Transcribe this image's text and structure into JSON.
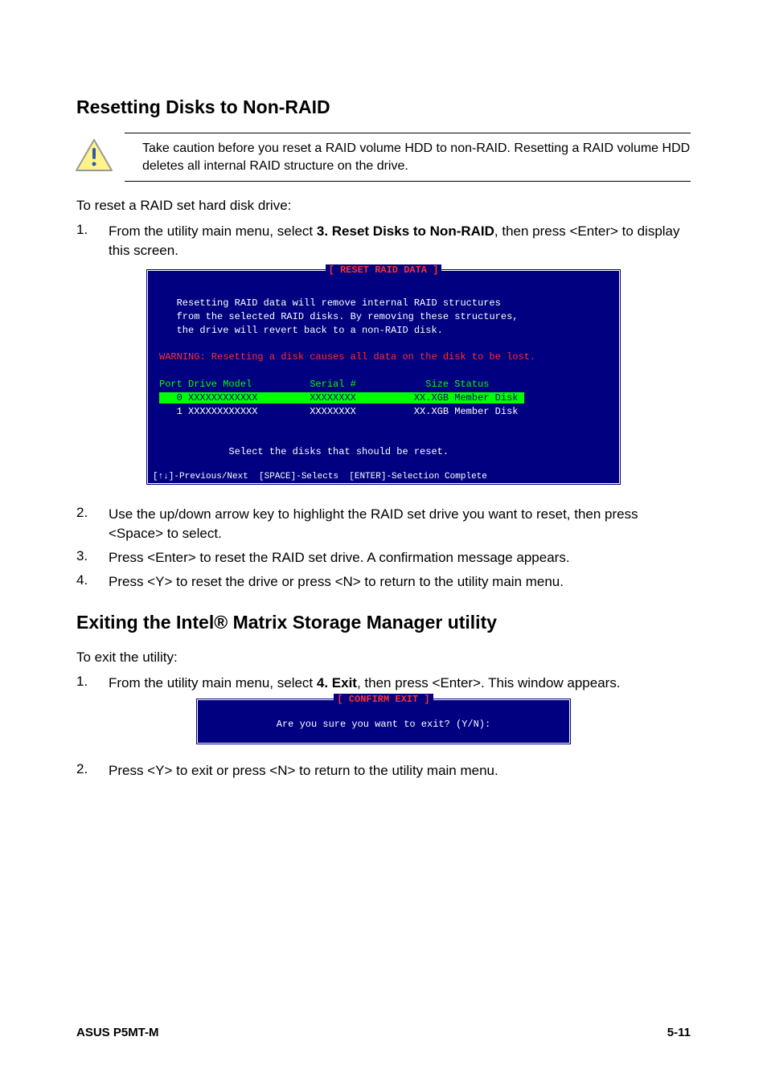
{
  "section1": {
    "heading": "Resetting Disks to Non-RAID",
    "caution": "Take caution before you reset a RAID volume HDD to non-RAID. Resetting a RAID volume HDD deletes all internal RAID structure on the drive.",
    "intro": "To reset a RAID set hard disk drive:",
    "step1": {
      "num": "1.",
      "pre": "From the utility main menu, select ",
      "menu": "3. Reset Disks to Non-RAID",
      "post": ", then press <Enter> to display this screen."
    },
    "bios": {
      "title": "[ RESET RAID DATA ]",
      "line1": "Resetting RAID data will remove internal RAID structures",
      "line2": "from the selected RAID disks. By removing these structures,",
      "line3": "the drive will revert back to a non-RAID disk.",
      "warning": "WARNING: Resetting a disk causes all data on the disk to be lost.",
      "header": "Port Drive Model          Serial #            Size Status",
      "row0": "   0 XXXXXXXXXXXX         XXXXXXXX          XX.XGB Member Disk ",
      "row1": "   1 XXXXXXXXXXXX         XXXXXXXX          XX.XGB Member Disk",
      "select_prompt": "Select the disks that should be reset.",
      "footer": "[↑↓]-Previous/Next  [SPACE]-Selects  [ENTER]-Selection Complete"
    },
    "step2": {
      "num": "2.",
      "text": "Use the up/down arrow key to highlight the RAID set drive you want to reset, then press <Space> to select."
    },
    "step3": {
      "num": "3.",
      "text": "Press <Enter> to reset the RAID set drive. A confirmation message appears."
    },
    "step4": {
      "num": "4.",
      "text": "Press <Y> to reset the drive or press <N> to return to the utility main menu."
    }
  },
  "section2": {
    "heading": "Exiting the Intel® Matrix Storage Manager utility",
    "intro": "To exit the utility:",
    "step1": {
      "num": "1.",
      "pre": "From the utility main menu, select ",
      "menu": "4. Exit",
      "post": ", then press <Enter>. This window appears."
    },
    "bios": {
      "title": "[ CONFIRM EXIT ]",
      "prompt": "Are you sure you want to exit? (Y/N):"
    },
    "step2": {
      "num": "2.",
      "text": "Press <Y> to exit or press <N> to return to the utility main menu."
    }
  },
  "footer": {
    "left": "ASUS P5MT-M",
    "right": "5-11"
  }
}
